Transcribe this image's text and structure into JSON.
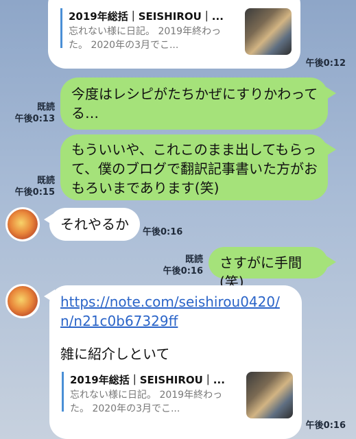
{
  "colors": {
    "sent_bubble": "#a5e27a",
    "recv_bubble": "#ffffff",
    "link": "#2a64c8"
  },
  "top_preview": {
    "title": "2019年総括｜SEISHIROU｜...",
    "desc": "忘れない様に日記。 2019年終わった。 2020年の3月でこ...",
    "time": "午後0:12"
  },
  "messages": [
    {
      "text": "今度はレシピがたちかぜにすりかわってる…",
      "read": "既読",
      "time": "午後0:13"
    },
    {
      "text": "もういいや、これこのまま出してもらって、僕のブログで翻訳記事書いた方がおもろいまであります(笑)",
      "read": "既読",
      "time": "午後0:15"
    },
    {
      "text": "それやるか",
      "time": "午後0:16"
    },
    {
      "text": "さすがに手間(笑)",
      "read": "既読",
      "time": "午後0:16"
    }
  ],
  "link_message": {
    "url": "https://note.com/seishirou0420/n/n21c0b67329ff",
    "text": "雑に紹介しといて",
    "preview_title": "2019年総括｜SEISHIROU｜...",
    "preview_desc": "忘れない様に日記。 2019年終わった。 2020年の3月でこ...",
    "time": "午後0:16"
  },
  "icons": {
    "avatar": "avatar-icon",
    "thumbnail": "thumbnail-image"
  }
}
